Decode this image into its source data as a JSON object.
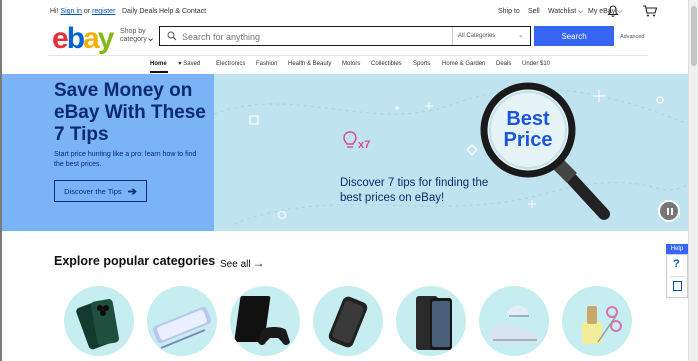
{
  "topbar": {
    "greeting": "Hi!",
    "sign_in": "Sign in",
    "or": "or",
    "register": "register",
    "daily_deals": "Daily Deals",
    "help_contact": "Help & Contact",
    "ship_to": "Ship to",
    "sell": "Sell",
    "watchlist": "Watchlist",
    "my_ebay": "My eBay"
  },
  "header": {
    "logo": {
      "e": "e",
      "b": "b",
      "a": "a",
      "y": "y"
    },
    "shop_by": "Shop by category",
    "search_placeholder": "Search for anything",
    "category_select": "All Categories",
    "search_button": "Search",
    "advanced": "Advanced"
  },
  "nav": {
    "items": [
      "Home",
      "Saved",
      "Electronics",
      "Fashion",
      "Health & Beauty",
      "Motors",
      "Collectibles",
      "Sports",
      "Home & Garden",
      "Deals",
      "Under $10"
    ],
    "saved_icon": "heart-icon"
  },
  "hero": {
    "title": "Save Money on eBay With These 7 Tips",
    "subtitle": "Start price hunting like a pro: learn how to find the best prices.",
    "cta": "Discover the Tips",
    "tagline": "Discover 7 tips for finding the best prices on eBay!",
    "bulb_count": "x7",
    "magnifier_text": "Best Price",
    "colors": {
      "left_bg": "#7ab3f6",
      "right_bg": "#c0e4ef",
      "navy": "#0b2a70"
    }
  },
  "help": {
    "label": "Help",
    "question": "?"
  },
  "categories": {
    "title": "Explore popular categories",
    "see_all": "See all",
    "items": [
      {
        "icon": "smartphone-icon"
      },
      {
        "icon": "stylus-phone-icon"
      },
      {
        "icon": "game-console-icon"
      },
      {
        "icon": "power-bank-icon"
      },
      {
        "icon": "tablet-phone-icon"
      },
      {
        "icon": "sneaker-icon"
      },
      {
        "icon": "nail-polish-icon"
      }
    ]
  },
  "colors": {
    "search_blue": "#3665f3",
    "link_blue": "#0654ba"
  }
}
